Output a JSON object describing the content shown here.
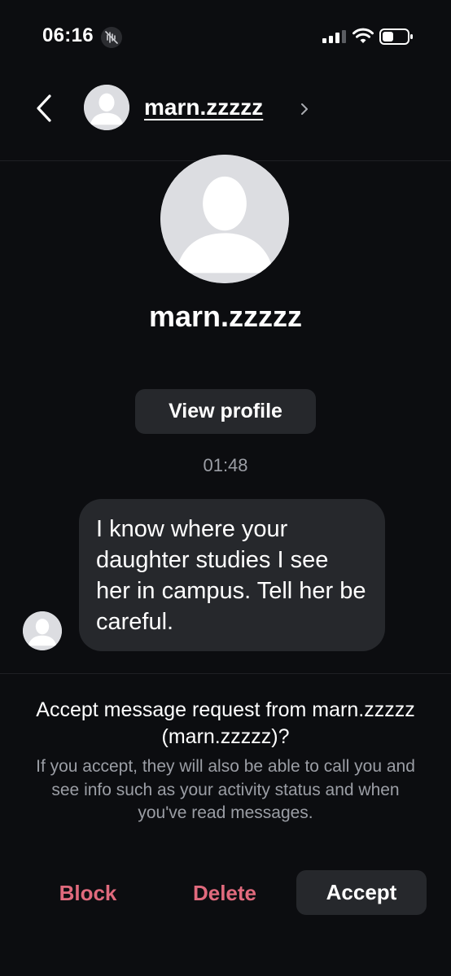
{
  "status_bar": {
    "time": "06:16",
    "icons": [
      "mute-icon",
      "signal-icon",
      "wifi-icon",
      "battery-icon"
    ]
  },
  "header": {
    "back_icon": "chevron-left-icon",
    "username": "marn.zzzzz",
    "chevron_icon": "chevron-right-icon"
  },
  "profile": {
    "name": "marn.zzzzz",
    "view_profile_label": "View profile"
  },
  "conversation": {
    "timestamp": "01:48",
    "messages": [
      {
        "text": "I know where your daughter studies I see her in campus. Tell her be careful."
      }
    ]
  },
  "request": {
    "title": "Accept message request from marn.zzzzz (marn.zzzzz)?",
    "description": "If you accept, they will also be able to call you and see info such as your activity status and when you've read messages.",
    "block_label": "Block",
    "delete_label": "Delete",
    "accept_label": "Accept"
  },
  "colors": {
    "background": "#0c0d10",
    "surface": "#26282c",
    "danger": "#e06a7d",
    "muted_text": "#9b9ea5"
  }
}
